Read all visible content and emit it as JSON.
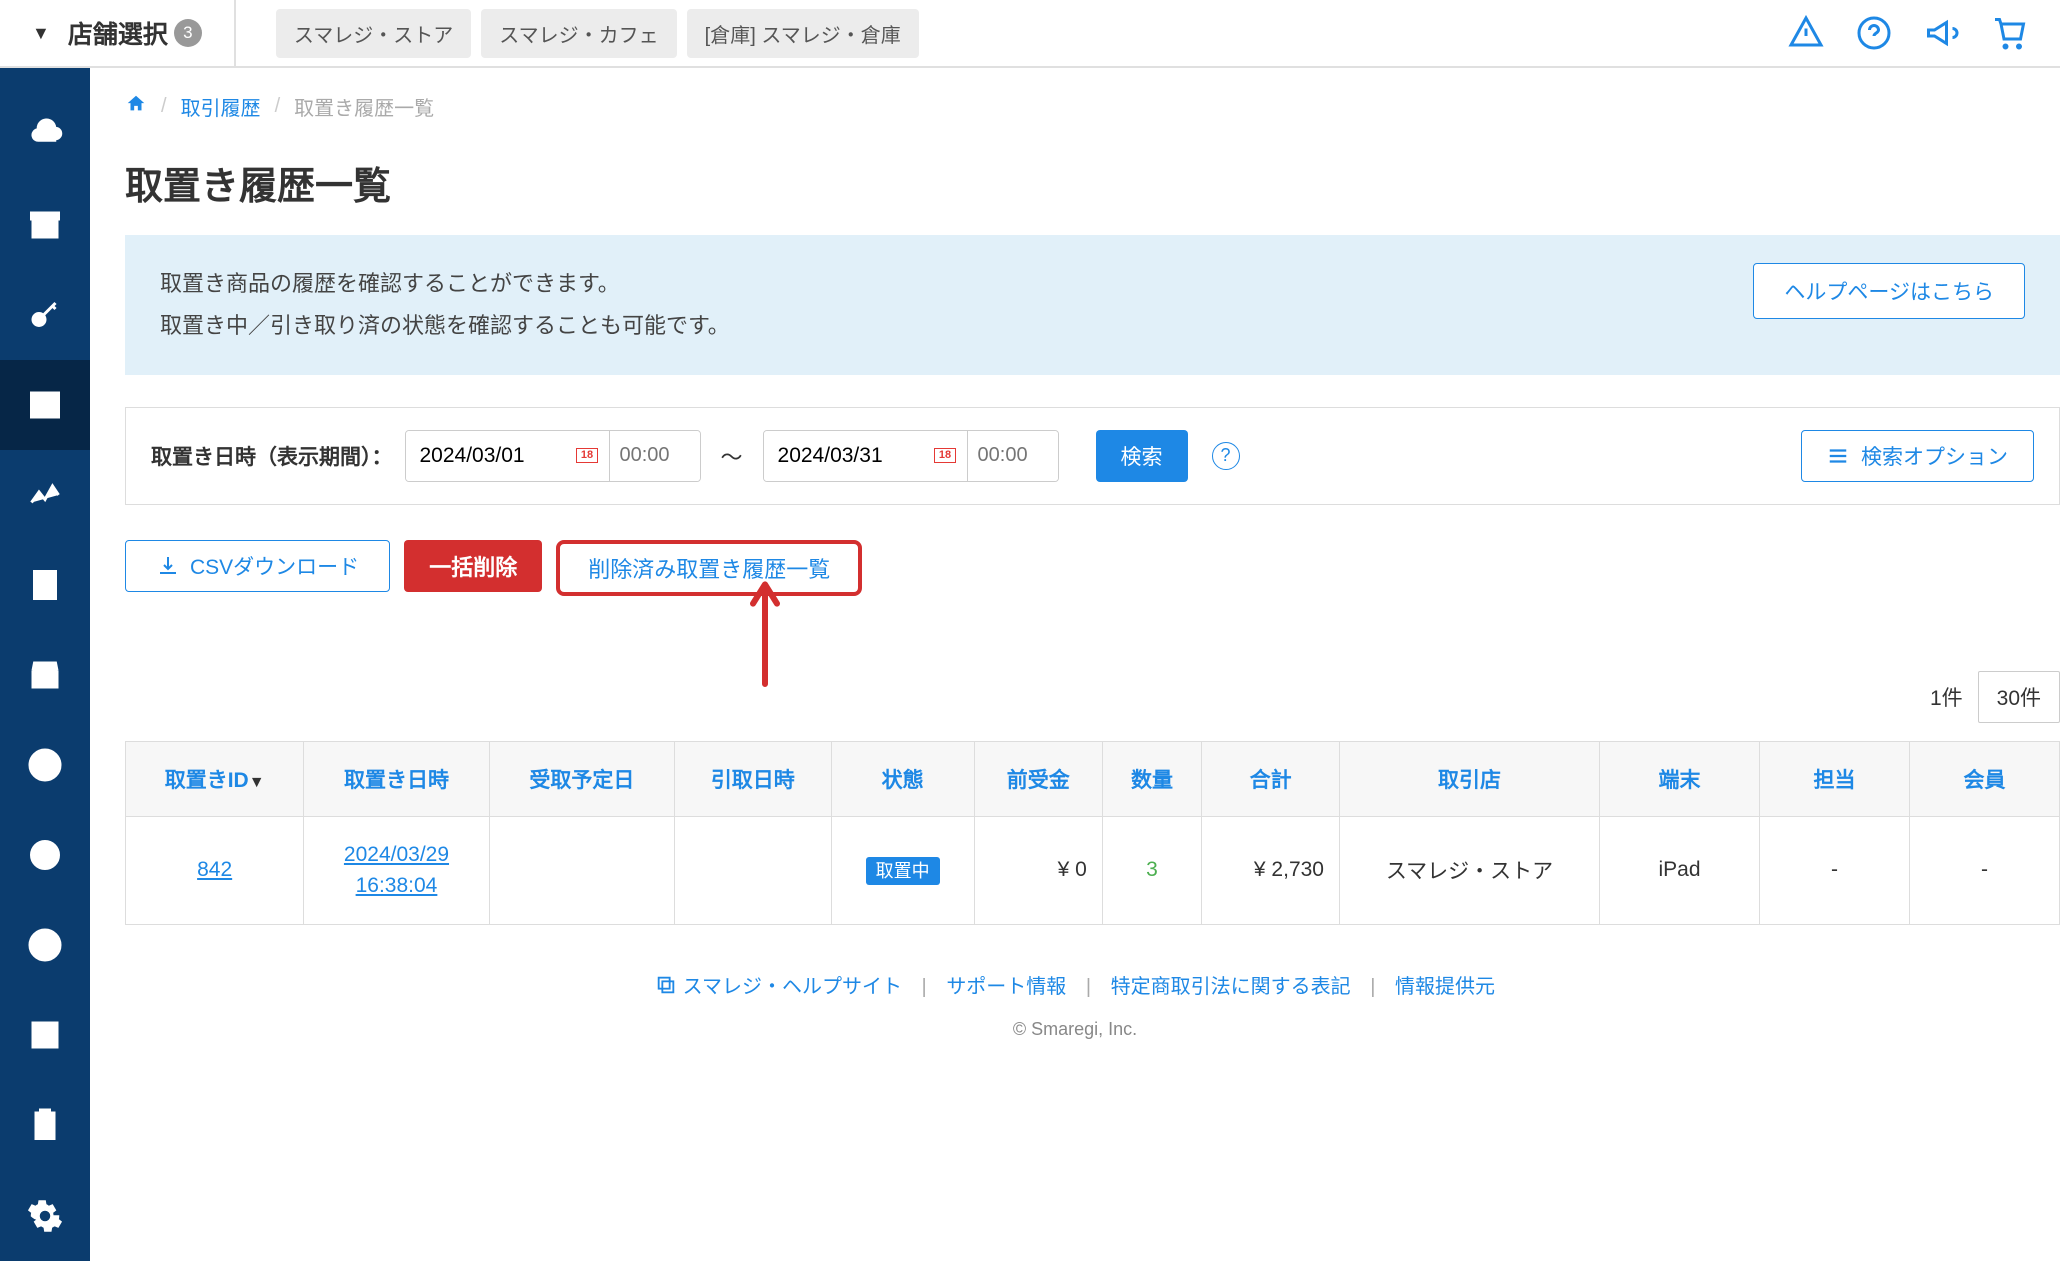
{
  "header": {
    "store_select_label": "店舗選択",
    "store_select_count": "3",
    "tabs": [
      "スマレジ・ストア",
      "スマレジ・カフェ",
      "[倉庫] スマレジ・倉庫"
    ]
  },
  "breadcrumb": {
    "link1": "取引履歴",
    "current": "取置き履歴一覧"
  },
  "page_title": "取置き履歴一覧",
  "info": {
    "line1": "取置き商品の履歴を確認することができます。",
    "line2": "取置き中／引き取り済の状態を確認することも可能です。",
    "help_btn": "ヘルプページはこちら"
  },
  "filter": {
    "label": "取置き日時（表示期間）：",
    "date_from": "2024/03/01",
    "time_from": "00:00",
    "date_to": "2024/03/31",
    "time_to": "00:00",
    "cal_day": "18",
    "search_btn": "検索",
    "search_opt": "検索オプション"
  },
  "actions": {
    "csv": "CSVダウンロード",
    "bulk_delete": "一括削除",
    "deleted_history": "削除済み取置き履歴一覧"
  },
  "pager": {
    "count_label": "1件",
    "page_size": "30件"
  },
  "table": {
    "headers": [
      "取置きID",
      "取置き日時",
      "受取予定日",
      "引取日時",
      "状態",
      "前受金",
      "数量",
      "合計",
      "取引店",
      "端末",
      "担当",
      "会員"
    ],
    "rows": [
      {
        "id": "842",
        "datetime": "2024/03/29\n16:38:04",
        "pickup_date": "",
        "pickup_time": "",
        "status": "取置中",
        "deposit": "¥ 0",
        "qty": "3",
        "total": "¥ 2,730",
        "store": "スマレジ・ストア",
        "terminal": "iPad",
        "staff": "-",
        "member": "-"
      }
    ]
  },
  "footer": {
    "link1": "スマレジ・ヘルプサイト",
    "link2": "サポート情報",
    "link3": "特定商取引法に関する表記",
    "link4": "情報提供元",
    "copyright": "© Smaregi, Inc."
  }
}
